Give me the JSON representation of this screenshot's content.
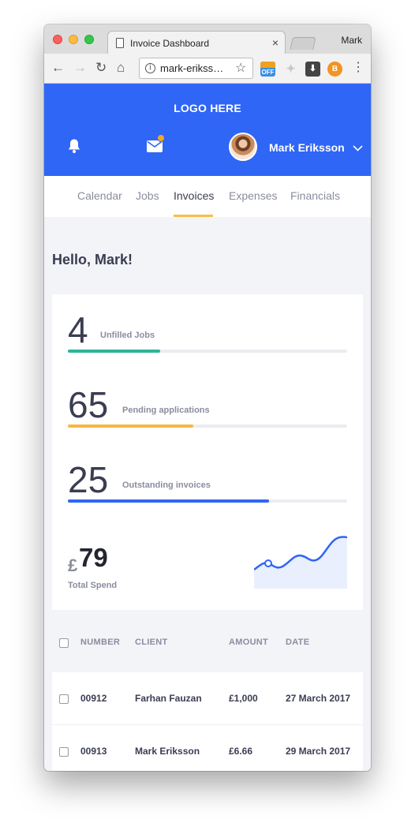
{
  "browser": {
    "tab_title": "Invoice Dashboard",
    "tab_close": "×",
    "profile_name": "Mark",
    "url": "mark-erikss…",
    "ext_off_label": "OFF",
    "ext_download_label": "⬇",
    "ext_bitcoin_label": "B"
  },
  "header": {
    "logo": "LOGO HERE",
    "user_name": "Mark Eriksson",
    "accent_color": "#2f66f6",
    "notification_dot_color": "#f5a623"
  },
  "nav": {
    "tabs": [
      {
        "label": "Calendar"
      },
      {
        "label": "Jobs"
      },
      {
        "label": "Invoices",
        "active": true
      },
      {
        "label": "Expenses"
      },
      {
        "label": "Financials"
      }
    ]
  },
  "greeting": "Hello, Mark!",
  "stats": [
    {
      "value": "4",
      "label": "Unfilled Jobs",
      "progress": 0.33,
      "color": "#2bb596"
    },
    {
      "value": "65",
      "label": "Pending applications",
      "progress": 0.45,
      "color": "#f5b942"
    },
    {
      "value": "25",
      "label": "Outstanding invoices",
      "progress": 0.72,
      "color": "#2f66f6"
    }
  ],
  "spend": {
    "currency": "£",
    "value": "79",
    "label": "Total Spend"
  },
  "table": {
    "headers": {
      "number": "NUMBER",
      "client": "CLIENT",
      "amount": "AMOUNT",
      "date": "DATE"
    },
    "rows": [
      {
        "number": "00912",
        "client": "Farhan Fauzan",
        "amount": "£1,000",
        "date": "27 March 2017"
      },
      {
        "number": "00913",
        "client": "Mark Eriksson",
        "amount": "£6.66",
        "date": "29 March 2017"
      }
    ]
  }
}
